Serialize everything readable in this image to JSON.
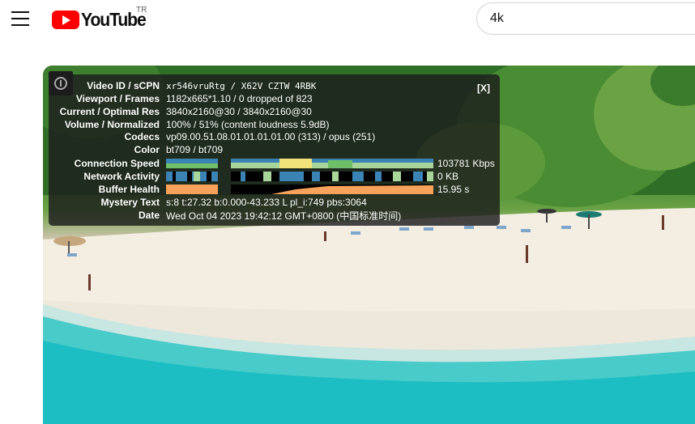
{
  "masthead": {
    "menu_icon": "hamburger-menu-icon",
    "logo_text": "YouTube",
    "country_code": "TR",
    "search_value": "4k",
    "brand_color": "#ff0000"
  },
  "stats": {
    "close_label": "[X]",
    "rows": [
      {
        "label": "Video ID / sCPN",
        "value": "xr546vruRtg  /  X62V CZTW 4RBK"
      },
      {
        "label": "Viewport / Frames",
        "value": "1182x665*1.10 / 0 dropped of 823"
      },
      {
        "label": "Current / Optimal Res",
        "value": "3840x2160@30 / 3840x2160@30"
      },
      {
        "label": "Volume / Normalized",
        "value": "100% / 51% (content loudness 5.9dB)"
      },
      {
        "label": "Codecs",
        "value": "vp09.00.51.08.01.01.01.01.00 (313) / opus (251)"
      },
      {
        "label": "Color",
        "value": "bt709 / bt709"
      },
      {
        "label": "Connection Speed",
        "value": "103781 Kbps"
      },
      {
        "label": "Network Activity",
        "value": "0 KB"
      },
      {
        "label": "Buffer Health",
        "value": "15.95 s"
      },
      {
        "label": "Mystery Text",
        "value": "s:8 t:27.32 b:0.000-43.233 L pl_i:749 pbs:3064"
      },
      {
        "label": "Date",
        "value": "Wed Oct 04 2023 19:42:12 GMT+0800 (中国标准时间)"
      }
    ]
  }
}
